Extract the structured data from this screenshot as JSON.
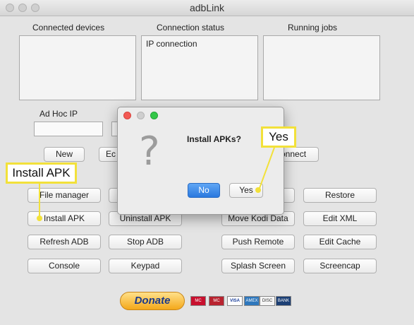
{
  "window": {
    "title": "adbLink"
  },
  "sections": {
    "connected_devices": "Connected devices",
    "connection_status": "Connection status",
    "running_jobs": "Running jobs"
  },
  "connection_status_value": "IP connection",
  "adhoc": {
    "label": "Ad Hoc IP",
    "value": ""
  },
  "buttons": {
    "new": "New",
    "edit_partial": "Ec",
    "connect_partial": "onnect",
    "file_manager": "File manager",
    "restore": "Restore",
    "install_apk": "Install APK",
    "uninstall_apk": "Uninstall APK",
    "move_kodi_data": "Move Kodi Data",
    "edit_xml": "Edit XML",
    "refresh_adb": "Refresh ADB",
    "stop_adb": "Stop ADB",
    "push_remote": "Push Remote",
    "edit_cache": "Edit Cache",
    "console": "Console",
    "keypad": "Keypad",
    "splash_screen": "Splash Screen",
    "screencap": "Screencap"
  },
  "dialog": {
    "title": "Install APKs?",
    "no": "No",
    "yes": "Yes",
    "icon": "question-icon"
  },
  "callouts": {
    "install_apk": "Install APK",
    "yes": "Yes"
  },
  "donate": {
    "label": "Donate",
    "cards": [
      "MC",
      "MC",
      "VISA",
      "AMEX",
      "DISC",
      "BANK"
    ]
  },
  "colors": {
    "callout": "#f2e13a",
    "default_button": "#2a78de",
    "donate": "#f4a81a"
  }
}
